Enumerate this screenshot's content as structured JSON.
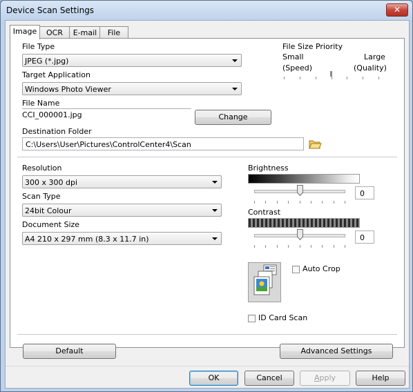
{
  "window": {
    "title": "Device Scan Settings",
    "close_label": "✕"
  },
  "tabs": [
    "Image",
    "OCR",
    "E-mail",
    "File"
  ],
  "file_type": {
    "label": "File Type",
    "value": "JPEG (*.jpg)"
  },
  "target_app": {
    "label": "Target Application",
    "value": "Windows Photo Viewer"
  },
  "file_name": {
    "label": "File Name",
    "value": "CCI_000001.jpg",
    "change_label": "Change"
  },
  "destination": {
    "label": "Destination Folder",
    "value": "C:\\Users\\User\\Pictures\\ControlCenter4\\Scan"
  },
  "file_size_priority": {
    "label": "File Size Priority",
    "left_label": "Small",
    "left_sub": "(Speed)",
    "right_label": "Large",
    "right_sub": "(Quality)",
    "level": 0.5
  },
  "resolution": {
    "label": "Resolution",
    "value": "300 x 300 dpi"
  },
  "scan_type": {
    "label": "Scan Type",
    "value": "24bit Colour"
  },
  "document_size": {
    "label": "Document Size",
    "value": "A4 210 x 297 mm (8.3 x 11.7 in)"
  },
  "brightness": {
    "label": "Brightness",
    "value": "0",
    "level": 0.5
  },
  "contrast": {
    "label": "Contrast",
    "value": "0",
    "level": 0.5
  },
  "auto_crop": {
    "label": "Auto Crop",
    "checked": false
  },
  "id_card_scan": {
    "label": "ID Card Scan",
    "checked": false
  },
  "panel_buttons": {
    "default_label": "Default",
    "advanced_label": "Advanced Settings"
  },
  "dialog_buttons": {
    "ok": "OK",
    "cancel": "Cancel",
    "apply": "Apply",
    "help": "Help"
  }
}
